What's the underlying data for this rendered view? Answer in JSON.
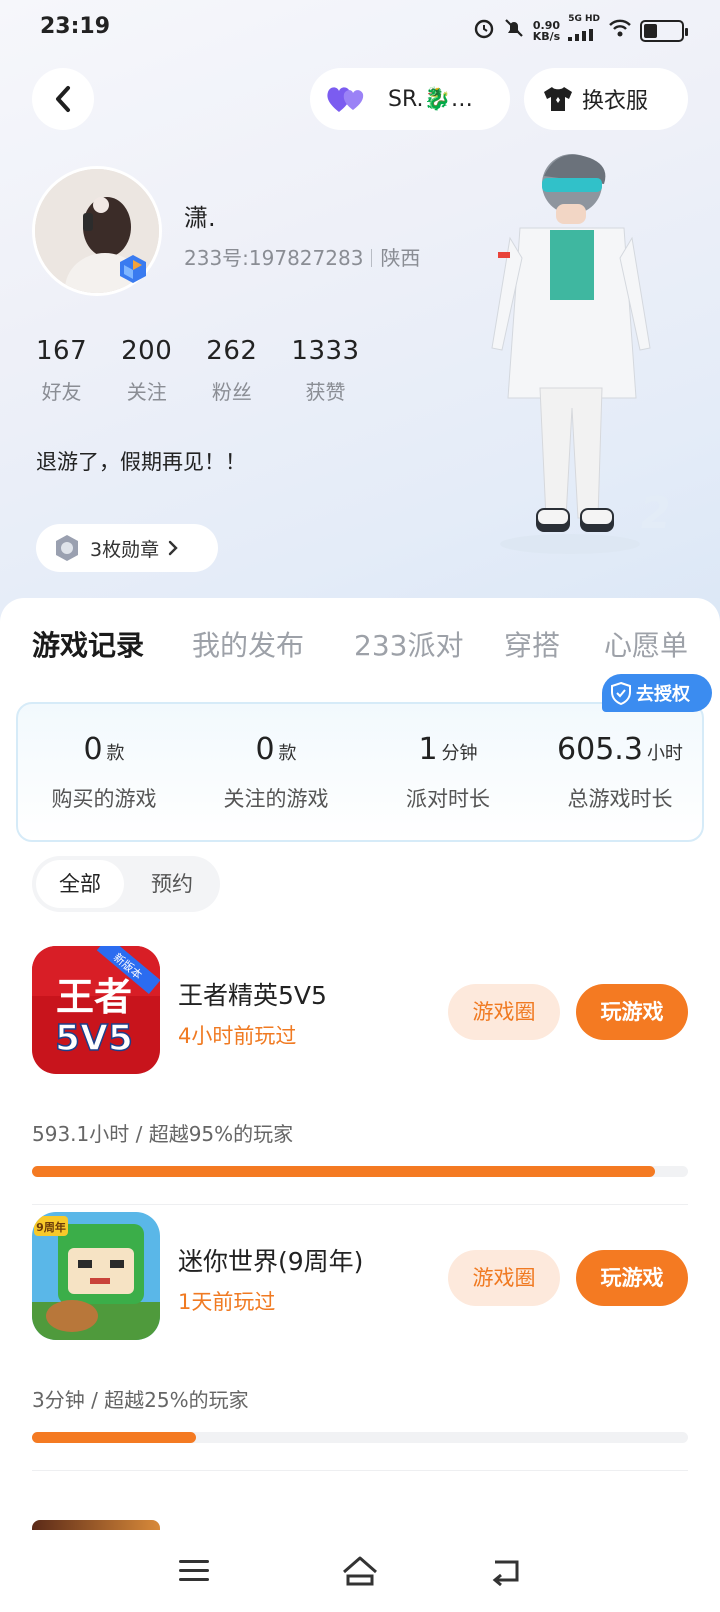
{
  "status_bar": {
    "time": "23:19",
    "net_speed_value": "0.90",
    "net_speed_unit": "KB/s",
    "network_tag": "5G HD",
    "battery_level": 0.35
  },
  "header": {
    "friend_name": "SR.🐉…",
    "outfit_label": "换衣服"
  },
  "profile": {
    "nickname": "潇.",
    "uid": "233号:197827283",
    "region": "陕西",
    "stats": [
      {
        "num": "167",
        "label": "好友"
      },
      {
        "num": "200",
        "label": "关注"
      },
      {
        "num": "262",
        "label": "粉丝"
      },
      {
        "num": "1333",
        "label": "获赞"
      }
    ],
    "bio": "退游了，假期再见！！",
    "medals": "3枚勋章"
  },
  "tabs": [
    {
      "label": "游戏记录",
      "active": true
    },
    {
      "label": "我的发布",
      "active": false
    },
    {
      "label": "233派对",
      "active": false
    },
    {
      "label": "穿搭",
      "active": false
    },
    {
      "label": "心愿单",
      "active": false
    }
  ],
  "summary": {
    "items": [
      {
        "value": "0",
        "unit": "款",
        "label": "购买的游戏"
      },
      {
        "value": "0",
        "unit": "款",
        "label": "关注的游戏"
      },
      {
        "value": "1",
        "unit": "分钟",
        "label": "派对时长"
      },
      {
        "value": "605.3",
        "unit": "小时",
        "label": "总游戏时长"
      }
    ],
    "auth_label": "去授权"
  },
  "filter": {
    "all": "全部",
    "reserve": "预约"
  },
  "games": [
    {
      "name": "王者精英5V5",
      "last_played": "4小时前玩过",
      "circle_label": "游戏圈",
      "play_label": "玩游戏",
      "stat": "593.1小时 / 超越95%的玩家",
      "progress": 0.95,
      "icon_text_top": "王者",
      "icon_text_bottom": "5V5",
      "icon_ribbon": "新版本"
    },
    {
      "name": "迷你世界(9周年)",
      "last_played": "1天前玩过",
      "circle_label": "游戏圈",
      "play_label": "玩游戏",
      "stat": "3分钟 / 超越25%的玩家",
      "progress": 0.25,
      "icon_badge": "9周年"
    }
  ],
  "colors": {
    "accent": "#f47a22",
    "accent_light": "#fde9dc",
    "auth_blue": "#3b8cf0",
    "heart_purple": "#7b5cf0"
  },
  "icons": {
    "back": "chevron-left-icon",
    "friend": "double-heart-icon",
    "outfit": "tshirt-icon",
    "medal": "medal-icon",
    "auth": "shield-check-icon",
    "nav": [
      "menu-icon",
      "home-icon",
      "back-arrow-icon"
    ]
  }
}
